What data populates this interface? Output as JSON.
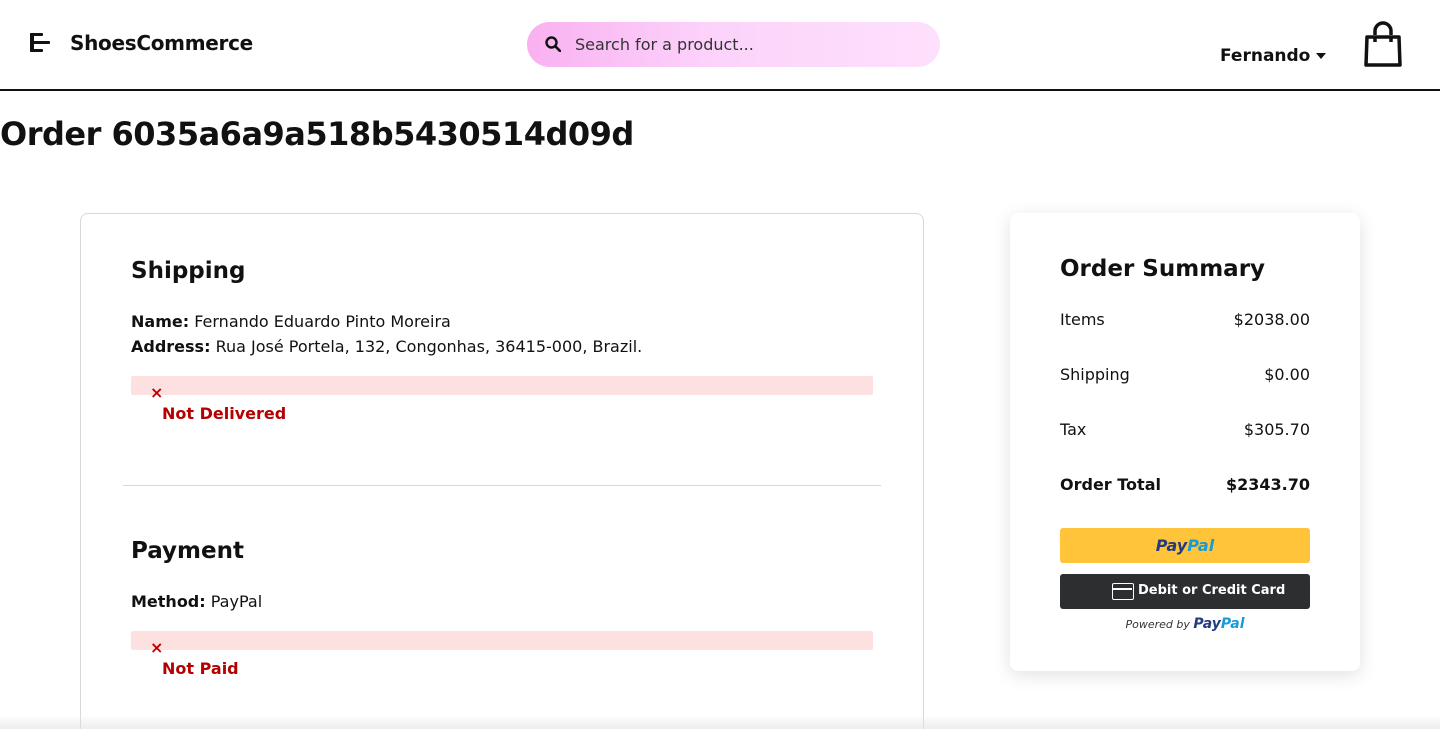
{
  "header": {
    "brand": "ShoesCommerce",
    "search_placeholder": "Search for a product...",
    "user_name": "Fernando"
  },
  "page_title": "Order 6035a6a9a518b5430514d09d",
  "shipping": {
    "title": "Shipping",
    "name_label": "Name:",
    "name_value": "Fernando Eduardo Pinto Moreira",
    "address_label": "Address:",
    "address_value": "Rua José Portela, 132, Congonhas, 36415-000, Brazil.",
    "status_icon": "×",
    "status_text": "Not Delivered"
  },
  "payment": {
    "title": "Payment",
    "method_label": "Method:",
    "method_value": "PayPal",
    "status_icon": "×",
    "status_text": "Not Paid"
  },
  "summary": {
    "title": "Order Summary",
    "rows": [
      {
        "label": "Items",
        "value": "$2038.00"
      },
      {
        "label": "Shipping",
        "value": "$0.00"
      },
      {
        "label": "Tax",
        "value": "$305.70"
      },
      {
        "label": "Order Total",
        "value": "$2343.70"
      }
    ],
    "paypal_a": "Pay",
    "paypal_b": "Pal",
    "card_button": "Debit or Credit Card",
    "powered_by": "Powered by"
  },
  "colors": {
    "accent_pink": "#f9b1f0",
    "alert_bg": "#fde1e1",
    "alert_text": "#b40000",
    "paypal_yellow": "#ffc439",
    "card_button_dark": "#2c2e2f"
  }
}
